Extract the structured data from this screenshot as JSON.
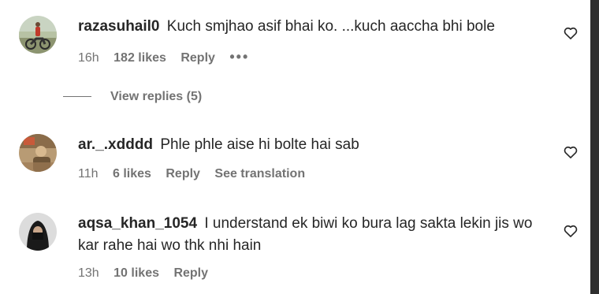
{
  "comments": [
    {
      "username": "razasuhail0",
      "text": "Kuch smjhao asif bhai ko. ...kuch aaccha bhi bole",
      "time": "16h",
      "likes": "182 likes",
      "reply": "Reply",
      "more": "•••",
      "avatar_icon": "avatar-person-on-motorcycle"
    },
    {
      "username": "ar._.xdddd",
      "text": "Phle phle aise hi bolte hai sab",
      "time": "11h",
      "likes": "6 likes",
      "reply": "Reply",
      "translation": "See translation",
      "avatar_icon": "avatar-person-photo"
    },
    {
      "username": "aqsa_khan_1054",
      "text": "I understand ek biwi ko bura lag sakta lekin jis wo kar rahe hai wo thk nhi hain",
      "time": "13h",
      "likes": "10 likes",
      "reply": "Reply",
      "avatar_icon": "avatar-hijab-woman"
    }
  ],
  "view_replies": "View replies (5)",
  "colors": {
    "text": "#262626",
    "secondary": "#737373",
    "scrollbar": "#2f2f2f"
  }
}
